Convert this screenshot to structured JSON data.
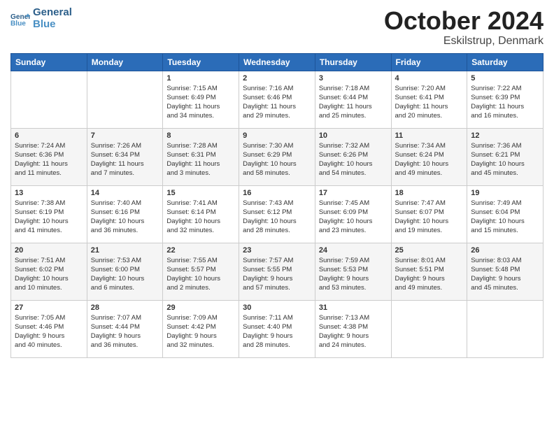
{
  "header": {
    "logo_general": "General",
    "logo_blue": "Blue",
    "title": "October 2024",
    "subtitle": "Eskilstrup, Denmark"
  },
  "weekdays": [
    "Sunday",
    "Monday",
    "Tuesday",
    "Wednesday",
    "Thursday",
    "Friday",
    "Saturday"
  ],
  "weeks": [
    [
      {
        "day": "",
        "info": ""
      },
      {
        "day": "",
        "info": ""
      },
      {
        "day": "1",
        "info": "Sunrise: 7:15 AM\nSunset: 6:49 PM\nDaylight: 11 hours\nand 34 minutes."
      },
      {
        "day": "2",
        "info": "Sunrise: 7:16 AM\nSunset: 6:46 PM\nDaylight: 11 hours\nand 29 minutes."
      },
      {
        "day": "3",
        "info": "Sunrise: 7:18 AM\nSunset: 6:44 PM\nDaylight: 11 hours\nand 25 minutes."
      },
      {
        "day": "4",
        "info": "Sunrise: 7:20 AM\nSunset: 6:41 PM\nDaylight: 11 hours\nand 20 minutes."
      },
      {
        "day": "5",
        "info": "Sunrise: 7:22 AM\nSunset: 6:39 PM\nDaylight: 11 hours\nand 16 minutes."
      }
    ],
    [
      {
        "day": "6",
        "info": "Sunrise: 7:24 AM\nSunset: 6:36 PM\nDaylight: 11 hours\nand 11 minutes."
      },
      {
        "day": "7",
        "info": "Sunrise: 7:26 AM\nSunset: 6:34 PM\nDaylight: 11 hours\nand 7 minutes."
      },
      {
        "day": "8",
        "info": "Sunrise: 7:28 AM\nSunset: 6:31 PM\nDaylight: 11 hours\nand 3 minutes."
      },
      {
        "day": "9",
        "info": "Sunrise: 7:30 AM\nSunset: 6:29 PM\nDaylight: 10 hours\nand 58 minutes."
      },
      {
        "day": "10",
        "info": "Sunrise: 7:32 AM\nSunset: 6:26 PM\nDaylight: 10 hours\nand 54 minutes."
      },
      {
        "day": "11",
        "info": "Sunrise: 7:34 AM\nSunset: 6:24 PM\nDaylight: 10 hours\nand 49 minutes."
      },
      {
        "day": "12",
        "info": "Sunrise: 7:36 AM\nSunset: 6:21 PM\nDaylight: 10 hours\nand 45 minutes."
      }
    ],
    [
      {
        "day": "13",
        "info": "Sunrise: 7:38 AM\nSunset: 6:19 PM\nDaylight: 10 hours\nand 41 minutes."
      },
      {
        "day": "14",
        "info": "Sunrise: 7:40 AM\nSunset: 6:16 PM\nDaylight: 10 hours\nand 36 minutes."
      },
      {
        "day": "15",
        "info": "Sunrise: 7:41 AM\nSunset: 6:14 PM\nDaylight: 10 hours\nand 32 minutes."
      },
      {
        "day": "16",
        "info": "Sunrise: 7:43 AM\nSunset: 6:12 PM\nDaylight: 10 hours\nand 28 minutes."
      },
      {
        "day": "17",
        "info": "Sunrise: 7:45 AM\nSunset: 6:09 PM\nDaylight: 10 hours\nand 23 minutes."
      },
      {
        "day": "18",
        "info": "Sunrise: 7:47 AM\nSunset: 6:07 PM\nDaylight: 10 hours\nand 19 minutes."
      },
      {
        "day": "19",
        "info": "Sunrise: 7:49 AM\nSunset: 6:04 PM\nDaylight: 10 hours\nand 15 minutes."
      }
    ],
    [
      {
        "day": "20",
        "info": "Sunrise: 7:51 AM\nSunset: 6:02 PM\nDaylight: 10 hours\nand 10 minutes."
      },
      {
        "day": "21",
        "info": "Sunrise: 7:53 AM\nSunset: 6:00 PM\nDaylight: 10 hours\nand 6 minutes."
      },
      {
        "day": "22",
        "info": "Sunrise: 7:55 AM\nSunset: 5:57 PM\nDaylight: 10 hours\nand 2 minutes."
      },
      {
        "day": "23",
        "info": "Sunrise: 7:57 AM\nSunset: 5:55 PM\nDaylight: 9 hours\nand 57 minutes."
      },
      {
        "day": "24",
        "info": "Sunrise: 7:59 AM\nSunset: 5:53 PM\nDaylight: 9 hours\nand 53 minutes."
      },
      {
        "day": "25",
        "info": "Sunrise: 8:01 AM\nSunset: 5:51 PM\nDaylight: 9 hours\nand 49 minutes."
      },
      {
        "day": "26",
        "info": "Sunrise: 8:03 AM\nSunset: 5:48 PM\nDaylight: 9 hours\nand 45 minutes."
      }
    ],
    [
      {
        "day": "27",
        "info": "Sunrise: 7:05 AM\nSunset: 4:46 PM\nDaylight: 9 hours\nand 40 minutes."
      },
      {
        "day": "28",
        "info": "Sunrise: 7:07 AM\nSunset: 4:44 PM\nDaylight: 9 hours\nand 36 minutes."
      },
      {
        "day": "29",
        "info": "Sunrise: 7:09 AM\nSunset: 4:42 PM\nDaylight: 9 hours\nand 32 minutes."
      },
      {
        "day": "30",
        "info": "Sunrise: 7:11 AM\nSunset: 4:40 PM\nDaylight: 9 hours\nand 28 minutes."
      },
      {
        "day": "31",
        "info": "Sunrise: 7:13 AM\nSunset: 4:38 PM\nDaylight: 9 hours\nand 24 minutes."
      },
      {
        "day": "",
        "info": ""
      },
      {
        "day": "",
        "info": ""
      }
    ]
  ]
}
